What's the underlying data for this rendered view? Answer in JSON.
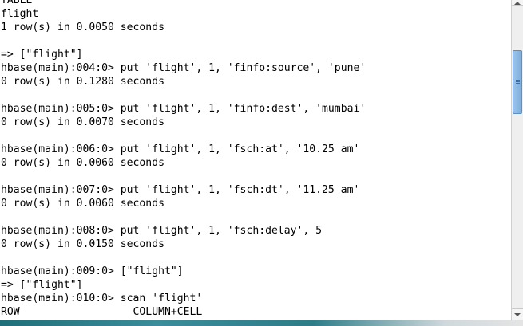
{
  "terminal": {
    "lines": [
      "TABLE",
      "flight",
      "1 row(s) in 0.0050 seconds",
      "",
      "=> [\"flight\"]",
      "hbase(main):004:0> put 'flight', 1, 'finfo:source', 'pune'",
      "0 row(s) in 0.1280 seconds",
      "",
      "hbase(main):005:0> put 'flight', 1, 'finfo:dest', 'mumbai'",
      "0 row(s) in 0.0070 seconds",
      "",
      "hbase(main):006:0> put 'flight', 1, 'fsch:at', '10.25 am'",
      "0 row(s) in 0.0060 seconds",
      "",
      "hbase(main):007:0> put 'flight', 1, 'fsch:dt', '11.25 am'",
      "0 row(s) in 0.0060 seconds",
      "",
      "hbase(main):008:0> put 'flight', 1, 'fsch:delay', 5",
      "0 row(s) in 0.0150 seconds",
      "",
      "hbase(main):009:0> [\"flight\"]",
      "=> [\"flight\"]",
      "hbase(main):010:0> scan 'flight'",
      "ROW                  COLUMN+CELL"
    ]
  },
  "scrollbar": {
    "up_icon": "chevron-up-icon",
    "down_icon": "chevron-down-icon"
  },
  "colors": {
    "text": "#000000",
    "background": "#ffffff",
    "scroll_thumb": "#8ab8e3"
  }
}
